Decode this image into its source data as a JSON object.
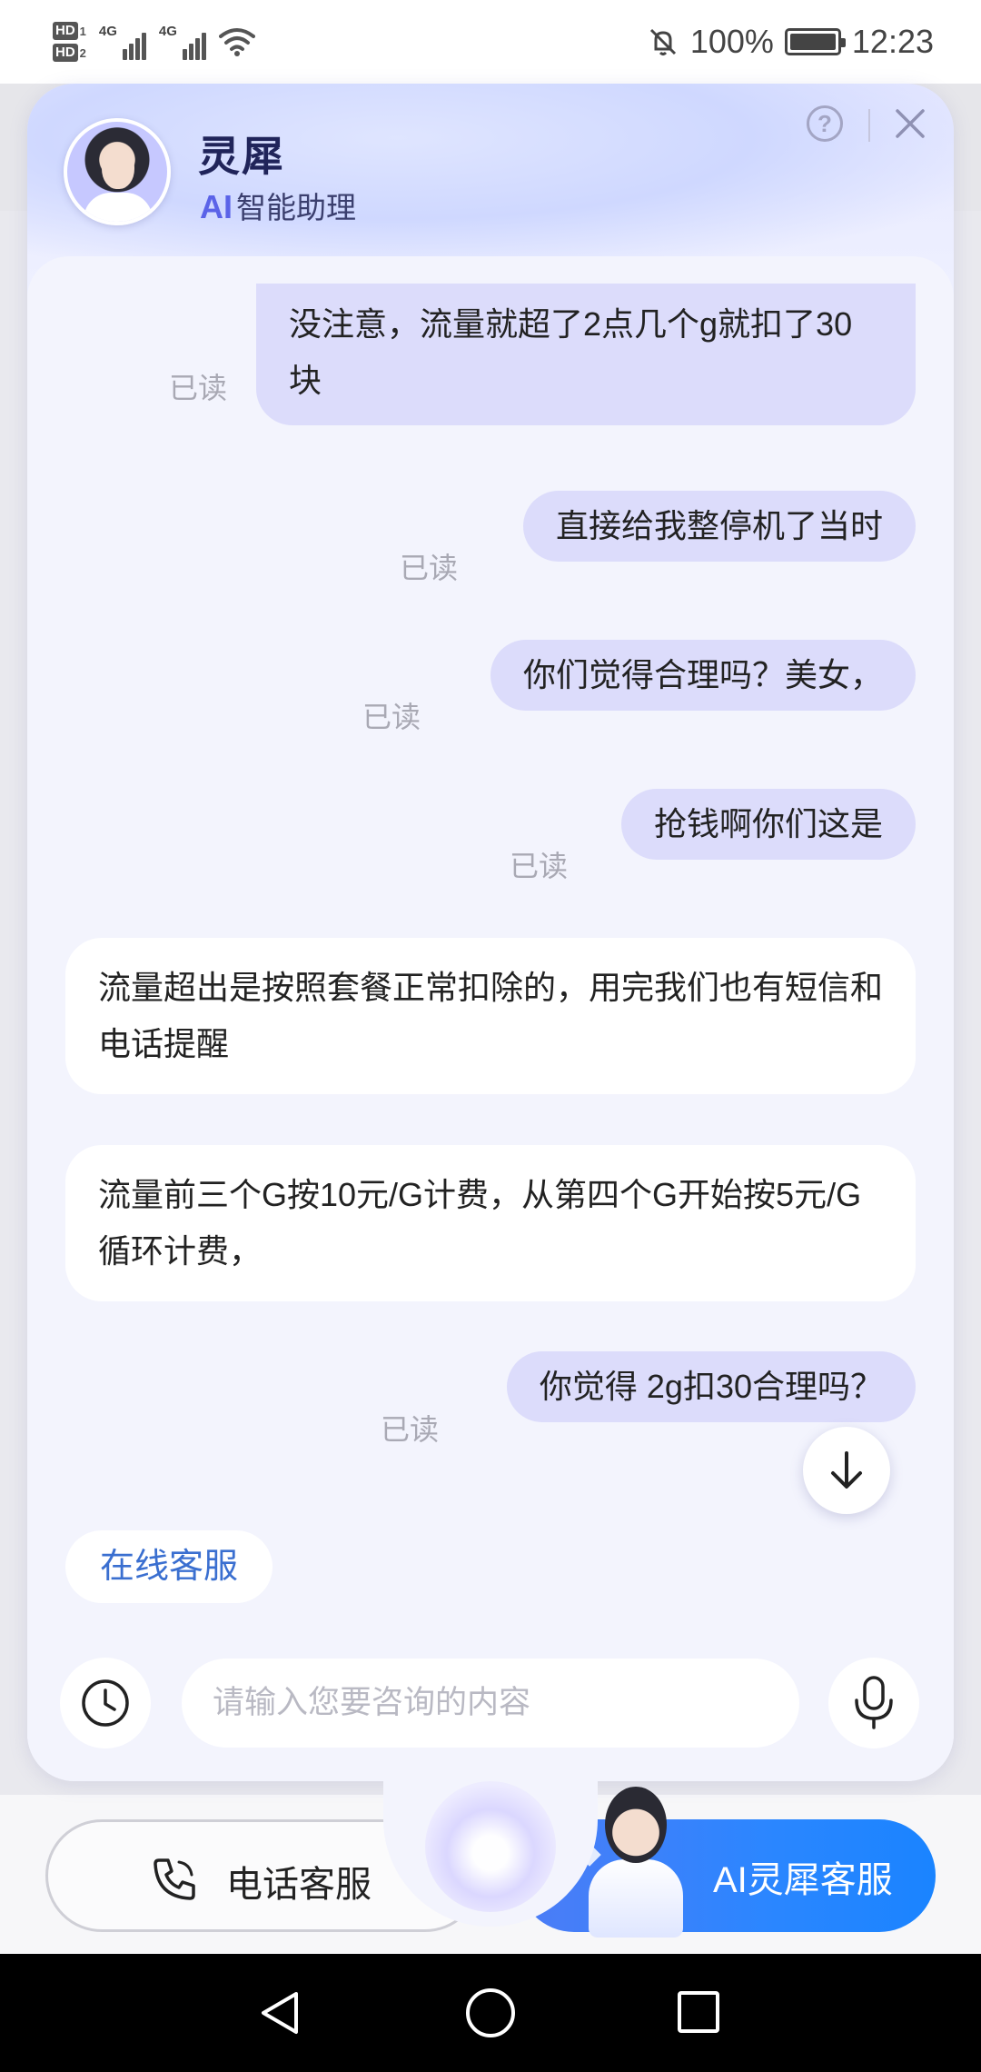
{
  "status_bar": {
    "hd1": "HD",
    "hd1_num": "1",
    "hd2": "HD",
    "hd2_num": "2",
    "net1": "4G",
    "net2": "4G",
    "battery": "100%",
    "time": "12:23",
    "icons": [
      "mute-icon",
      "wifi-icon",
      "battery-icon",
      "signal-icon"
    ]
  },
  "header": {
    "title": "灵犀",
    "subtitle_ai": "AI",
    "subtitle_rest": "智能助理",
    "help_label": "?"
  },
  "messages": [
    {
      "role": "user",
      "text": "没注意，流量就超了2点几个g就扣了30块",
      "status": "已读"
    },
    {
      "role": "user",
      "text": "直接给我整停机了当时",
      "status": "已读"
    },
    {
      "role": "user",
      "text": "你们觉得合理吗？美女，",
      "status": "已读"
    },
    {
      "role": "user",
      "text": "抢钱啊你们这是",
      "status": "已读"
    },
    {
      "role": "bot",
      "text": "流量超出是按照套餐正常扣除的，用完我们也有短信和电话提醒"
    },
    {
      "role": "bot",
      "text": "流量前三个G按10元/G计费，从第四个G开始按5元/G循环计费，"
    },
    {
      "role": "user",
      "text": "你觉得 2g扣30合理吗？",
      "status": "已读"
    }
  ],
  "quick_reply": "在线客服",
  "input": {
    "placeholder": "请输入您要咨询的内容",
    "value": ""
  },
  "bottom_tabs": {
    "phone": "电话客服",
    "ai": "AI灵犀客服"
  },
  "colors": {
    "user_bubble": "#dcdcfb",
    "bot_bubble": "#ffffff",
    "accent": "#1a84ff",
    "read_text": "#a9a9b4"
  }
}
